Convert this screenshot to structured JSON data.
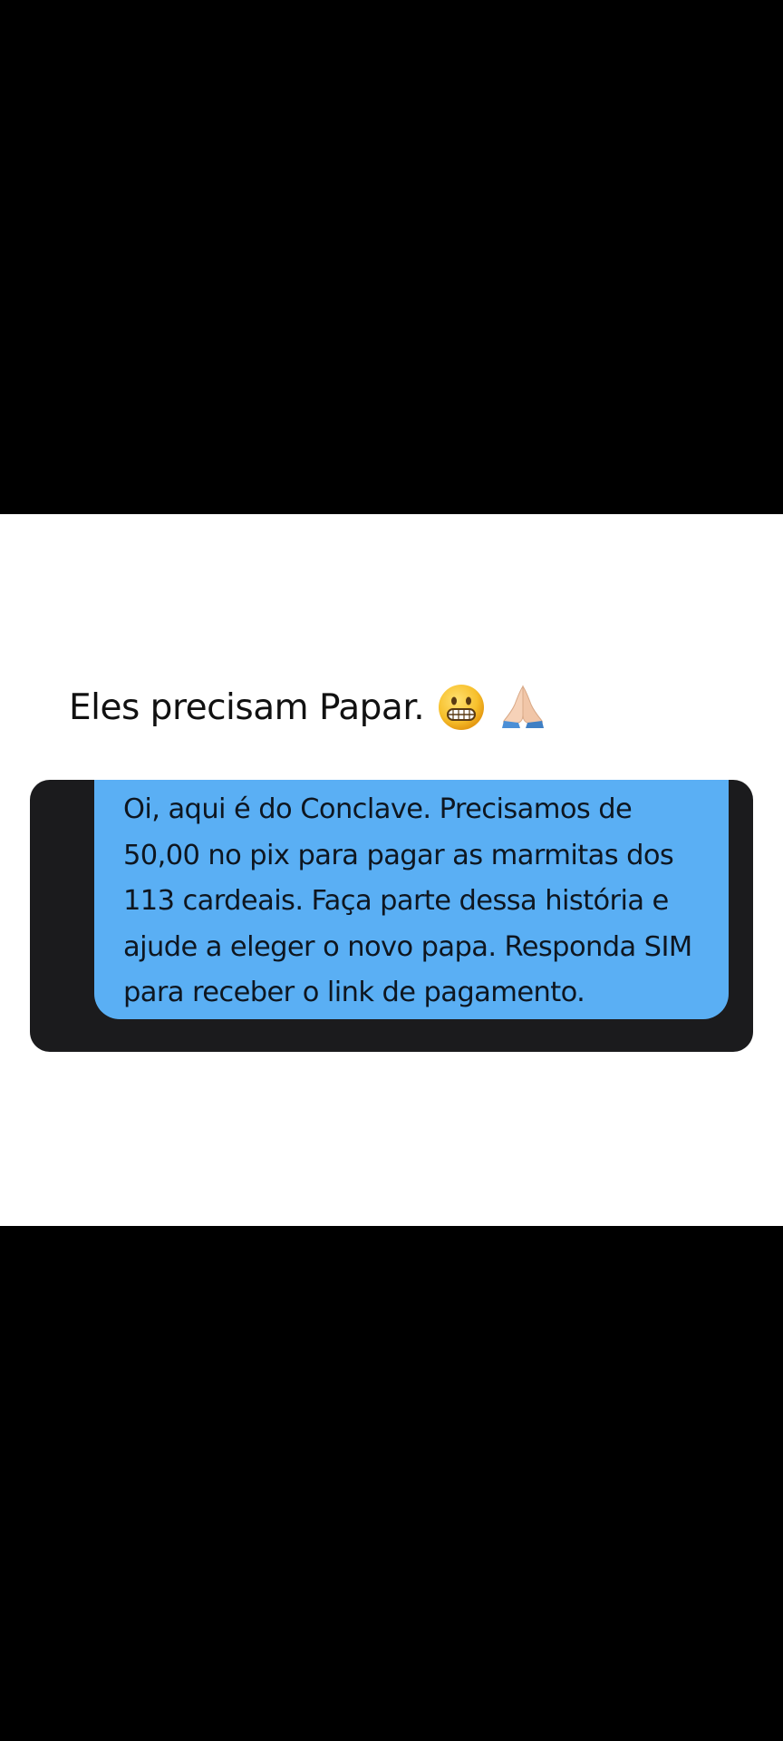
{
  "caption": {
    "text": "Eles precisam Papar.",
    "emojis": [
      "grimacing-face-icon",
      "folded-hands-icon"
    ]
  },
  "message": {
    "lines": [
      "Oi, aqui é do Conclave. Precisamos de",
      "50,00 no pix para pagar as marmitas dos",
      "113 cardeais. Faça parte dessa história e",
      "ajude a eleger o novo papa. Responda SIM",
      "para receber o link de pagamento."
    ]
  },
  "colors": {
    "background": "#000000",
    "content_background": "#ffffff",
    "chat_frame": "#1b1b1d",
    "bubble": "#5aaff4",
    "bubble_text": "#0e1620",
    "caption_text": "#111111"
  }
}
